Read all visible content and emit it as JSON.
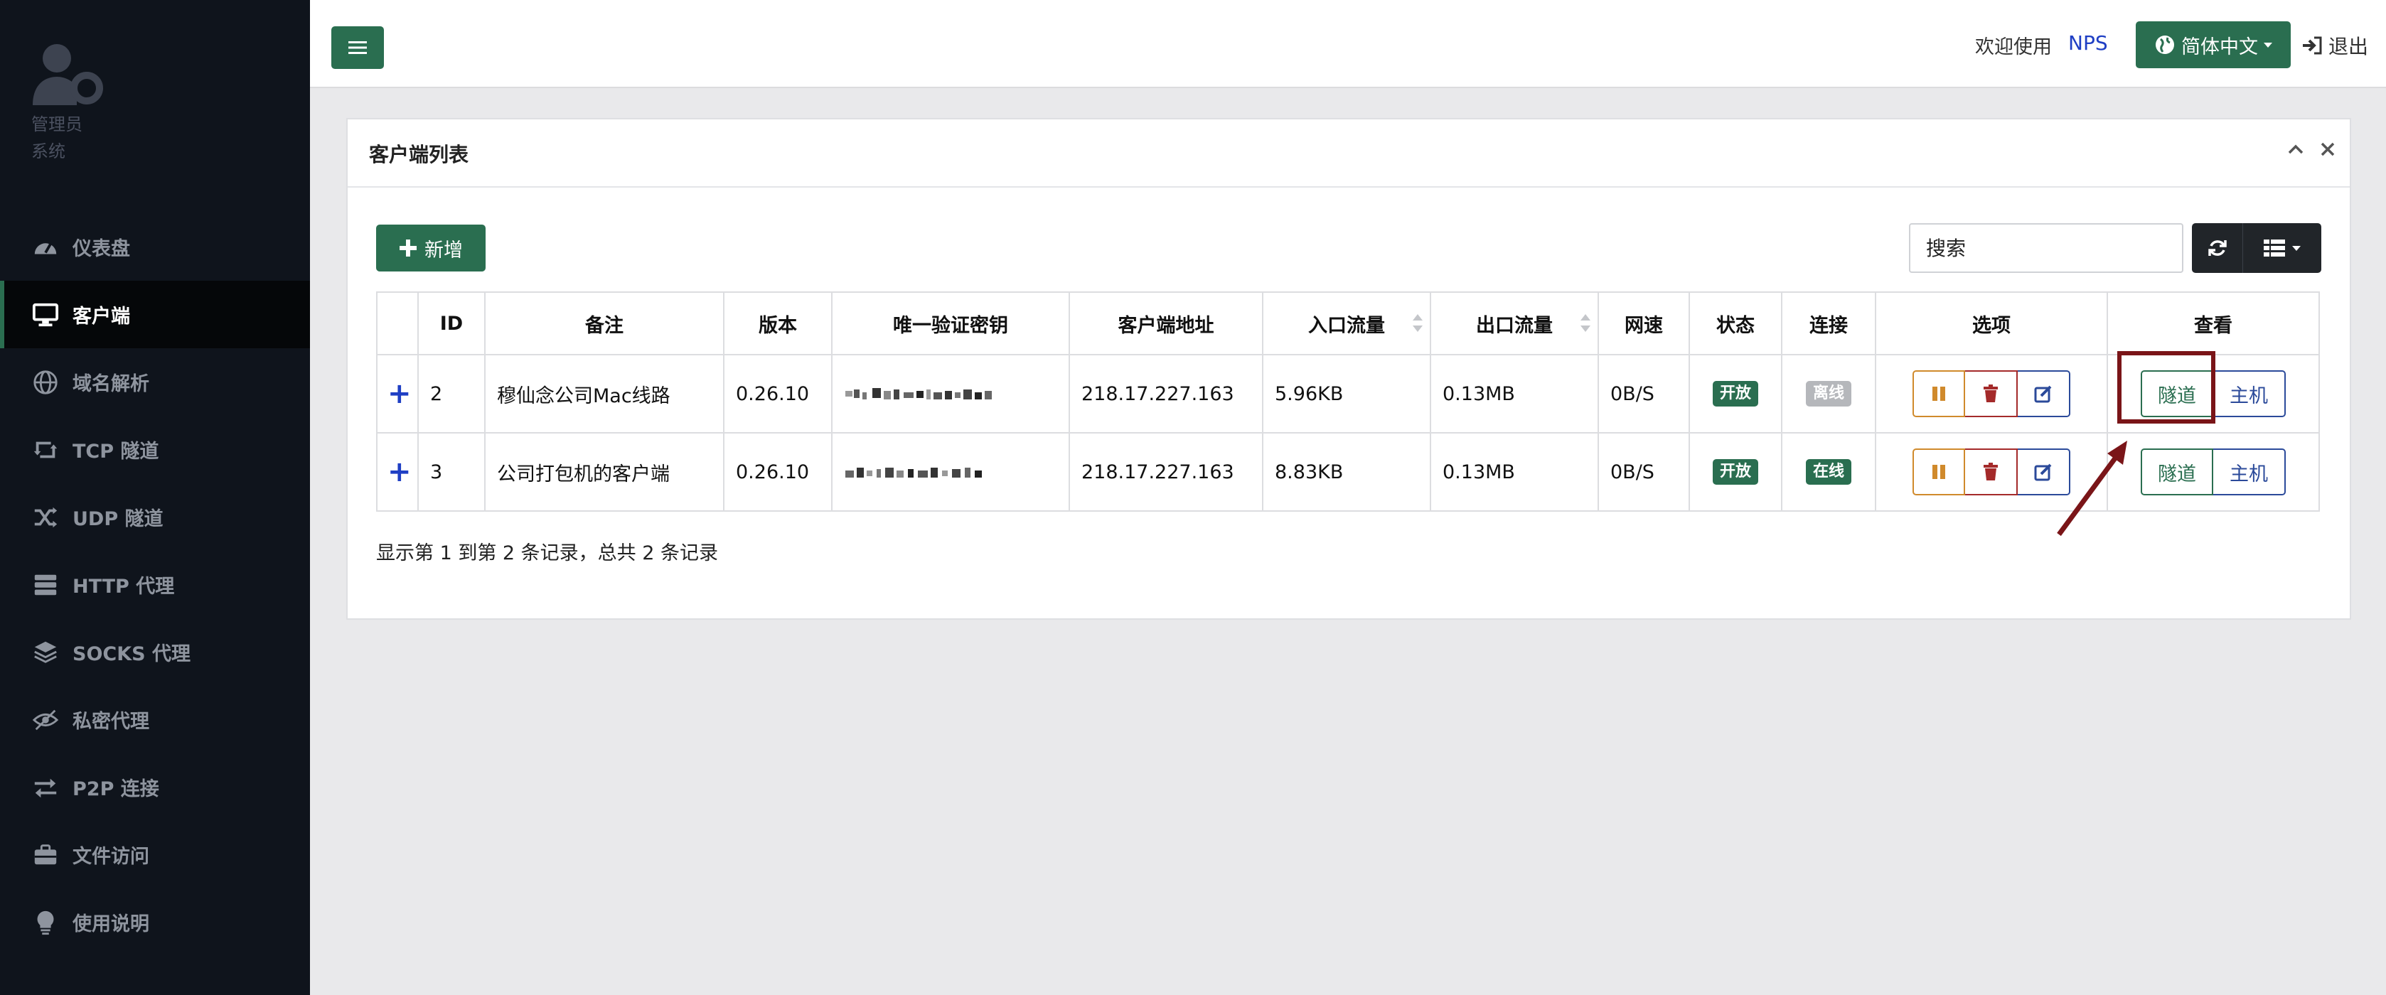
{
  "sidebar": {
    "profile": {
      "role": "管理员",
      "name": "系统"
    },
    "items": [
      {
        "label": "仪表盘",
        "icon": "dashboard-icon"
      },
      {
        "label": "客户端",
        "icon": "desktop-icon",
        "active": true
      },
      {
        "label": "域名解析",
        "icon": "globe-icon"
      },
      {
        "label": "TCP 隧道",
        "icon": "retweet-icon"
      },
      {
        "label": "UDP 隧道",
        "icon": "random-icon"
      },
      {
        "label": "HTTP 代理",
        "icon": "server-icon"
      },
      {
        "label": "SOCKS 代理",
        "icon": "layers-icon"
      },
      {
        "label": "私密代理",
        "icon": "eye-slash-icon"
      },
      {
        "label": "P2P 连接",
        "icon": "exchange-icon"
      },
      {
        "label": "文件访问",
        "icon": "briefcase-icon"
      },
      {
        "label": "使用说明",
        "icon": "lightbulb-icon"
      }
    ]
  },
  "header": {
    "welcome": "欢迎使用",
    "brand": "NPS",
    "language": "简体中文",
    "logout": "退出"
  },
  "panel": {
    "title": "客户端列表",
    "add_label": "新增",
    "search_placeholder": "搜索",
    "columns": [
      "",
      "ID",
      "备注",
      "版本",
      "唯一验证密钥",
      "客户端地址",
      "入口流量",
      "出口流量",
      "网速",
      "状态",
      "连接",
      "选项",
      "查看"
    ],
    "rows": [
      {
        "expand": "+",
        "id": "2",
        "remark": "穆仙念公司Mac线路",
        "version": "0.26.10",
        "address": "218.17.227.163",
        "in_flow": "5.96KB",
        "out_flow": "0.13MB",
        "speed": "0B/S",
        "status": "开放",
        "connection": "离线",
        "connection_state": "offline",
        "view_tunnel": "隧道",
        "view_host": "主机"
      },
      {
        "expand": "+",
        "id": "3",
        "remark": "公司打包机的客户端",
        "version": "0.26.10",
        "address": "218.17.227.163",
        "in_flow": "8.83KB",
        "out_flow": "0.13MB",
        "speed": "0B/S",
        "status": "开放",
        "connection": "在线",
        "connection_state": "online",
        "view_tunnel": "隧道",
        "view_host": "主机"
      }
    ],
    "footer": "显示第 1 到第 2 条记录，总共 2 条记录"
  },
  "colors": {
    "accent": "#2a6e50",
    "sidebar_bg": "#0f141c",
    "link_blue": "#1f3fc4",
    "annotation": "#7a1518",
    "warning": "#d08a2c",
    "danger": "#a42a2a",
    "info": "#2b4a9a"
  }
}
